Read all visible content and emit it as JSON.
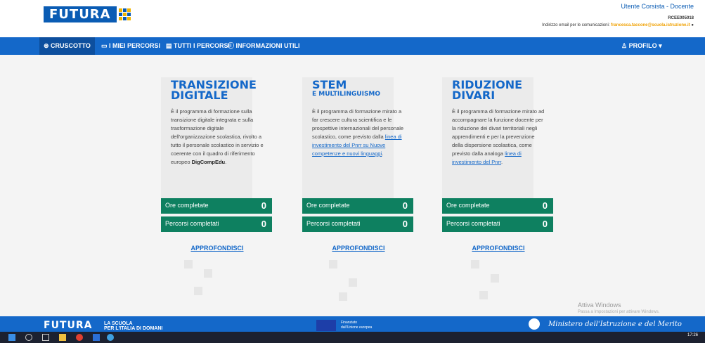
{
  "header": {
    "logo_text": "FUTURA",
    "user_role": "Utente Corsista - Docente",
    "user_code": "RCEE005018",
    "mail_label": "Indirizzo email per le comunicazioni:",
    "mail_value": "francesca.taccone@scuola.istruzione.it"
  },
  "nav": {
    "items": [
      {
        "label": "⊛ CRUSCOTTO"
      },
      {
        "label": "▭ I MIEI PERCORSI"
      },
      {
        "label": "▤ TUTTI I PERCORSI"
      },
      {
        "label": "ⓘ INFORMAZIONI UTILI"
      }
    ],
    "profile": "♙ PROFILO ▾"
  },
  "cards": [
    {
      "title_line1": "TRANSIZIONE",
      "title_line2": "DIGITALE",
      "desc": "È il programma di formazione sulla transizione digitale integrata e sulla trasformazione digitale dell'organizzazione scolastica, rivolto a tutto il personale scolastico in servizio e coerente con il quadro di riferimento europeo ",
      "desc_bold": "DigCompEdu",
      "desc_end": ".",
      "hours_label": "Ore completate",
      "hours_value": "0",
      "paths_label": "Percorsi completati",
      "paths_value": "0",
      "more": "APPROFONDISCI"
    },
    {
      "title_line1": "STEM",
      "subtitle": "E MULTILINGUISMO",
      "desc": "È il programma di formazione mirato a far crescere cultura scientifica e le prospettive internazionali del personale scolastico, come previsto dalla ",
      "desc_link": "linea di investimento del Pnrr su Nuove competenze e nuovi linguaggi",
      "desc_end": ".",
      "hours_label": "Ore completate",
      "hours_value": "0",
      "paths_label": "Percorsi completati",
      "paths_value": "0",
      "more": "APPROFONDISCI"
    },
    {
      "title_line1": "RIDUZIONE",
      "title_line2": "DIVARI",
      "desc": "È il programma di formazione mirato ad accompagnare la funzione docente per la riduzione dei divari territoriali negli apprendimenti e per la prevenzione della dispersione scolastica, come previsto dalla analoga ",
      "desc_link": "linea di investimento del Pnrr",
      "desc_end": ".",
      "hours_label": "Ore completate",
      "hours_value": "0",
      "paths_label": "Percorsi completati",
      "paths_value": "0",
      "more": "APPROFONDISCI"
    }
  ],
  "watermark": {
    "line1": "Attiva Windows",
    "line2": "Passa a Impostazioni per attivare Windows."
  },
  "footer": {
    "logo": "FUTURA",
    "tag1": "LA SCUOLA",
    "tag2": "PER L'ITALIA DI DOMANI",
    "eu_line1": "Finanziato",
    "eu_line2": "dall'Unione europea",
    "ministry": "Ministero dell'Istruzione e del Merito"
  },
  "taskbar": {
    "time": "17:26"
  }
}
